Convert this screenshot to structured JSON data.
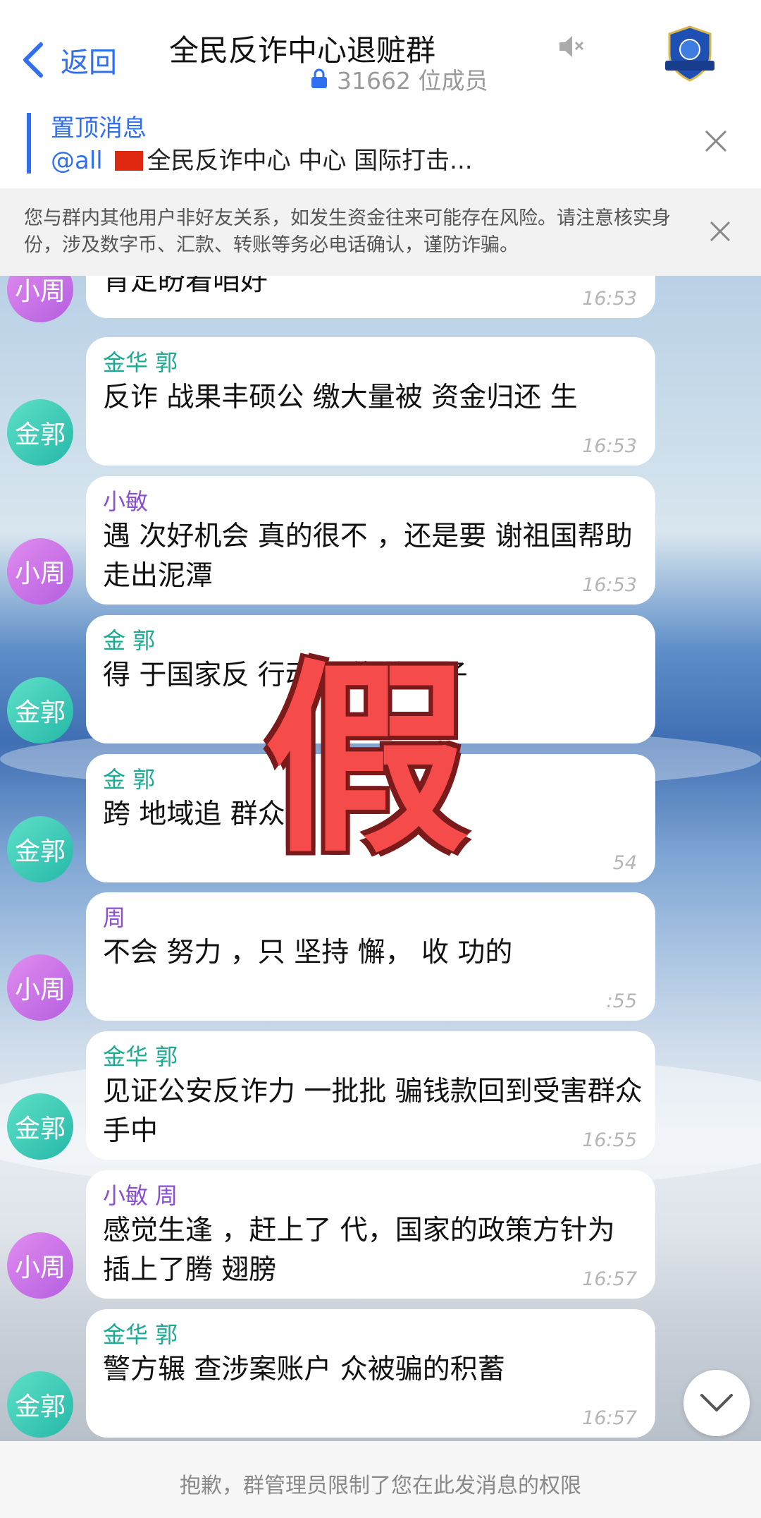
{
  "header": {
    "back_label": "返回",
    "title": "全民反诈中心退赃群",
    "member_count": "31662 位成员"
  },
  "pinned": {
    "label": "置顶消息",
    "at": "@all",
    "text": "全民反诈中心  中心  国际打击..."
  },
  "warning": {
    "text": "您与群内其他用户非好友关系，如发生资金往来可能存在风险。请注意核实身份，涉及数字币、汇款、转账等务必电话确认，谨防诈骗。"
  },
  "messages": [
    {
      "avatar": "小周",
      "avatar_color": "purple",
      "sender": "",
      "text": "肯定盼着咱好",
      "time": "16:53"
    },
    {
      "avatar": "金郭",
      "avatar_color": "teal",
      "sender": "金华 郭",
      "text": "反诈 战果丰硕公 缴大量被 资金归还 生",
      "time": "16:53"
    },
    {
      "avatar": "小周",
      "avatar_color": "purple",
      "sender": "小敏",
      "text": "遇 次好机会 真的很不 ，还是要 谢祖国帮助 走出泥潭",
      "time": "16:53"
    },
    {
      "avatar": "金郭",
      "avatar_color": "teal",
      "sender": "金 郭",
      "text": "得 于国家反 行动 回往后 日子",
      "time": ""
    },
    {
      "avatar": "金郭",
      "avatar_color": "teal",
      "sender": "金 郭",
      "text": "跨 地域追 群众挽 失",
      "time": "54"
    },
    {
      "avatar": "小周",
      "avatar_color": "purple",
      "sender": "周",
      "text": "不会 努力 ，只 坚持 懈， 收 功的",
      "time": ":55"
    },
    {
      "avatar": "金郭",
      "avatar_color": "teal",
      "sender": "金华 郭",
      "text": "见证公安反诈力 一批批 骗钱款回到受害群众手中",
      "time": "16:55"
    },
    {
      "avatar": "小周",
      "avatar_color": "purple",
      "sender": "小敏 周",
      "text": "感觉生逢 ，赶上了 代，国家的政策方针为 插上了腾 翅膀",
      "time": "16:57"
    },
    {
      "avatar": "金郭",
      "avatar_color": "teal",
      "sender": "金华 郭",
      "text": "警方辗 查涉案账户 众被骗的积蓄",
      "time": "16:57"
    }
  ],
  "stamp_text": "假",
  "footer": {
    "text": "抱歉，群管理员限制了您在此发消息的权限"
  }
}
